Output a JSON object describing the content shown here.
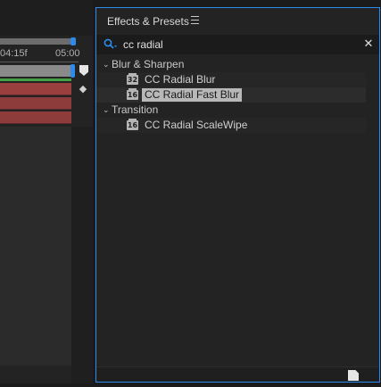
{
  "timeline": {
    "ruler_labels": [
      "04:15f",
      "05:00"
    ]
  },
  "panel": {
    "title": "Effects & Presets",
    "menu_icon": "hamburger-menu-icon"
  },
  "search": {
    "value": "cc radial",
    "icon": "search-icon",
    "clear_icon": "close-icon"
  },
  "tree": {
    "folders": [
      {
        "label": "Blur & Sharpen",
        "items": [
          {
            "bit_depth": "32",
            "label": "CC Radial Blur",
            "selected": false
          },
          {
            "bit_depth": "16",
            "label": "CC Radial Fast Blur",
            "selected": true
          }
        ]
      },
      {
        "label": "Transition",
        "items": [
          {
            "bit_depth": "16",
            "label": "CC Radial ScaleWipe",
            "selected": false
          }
        ]
      }
    ]
  },
  "colors": {
    "accent": "#2d8ceb",
    "layer_red": "#8e3b3b",
    "selection": "#b8b8b8"
  }
}
